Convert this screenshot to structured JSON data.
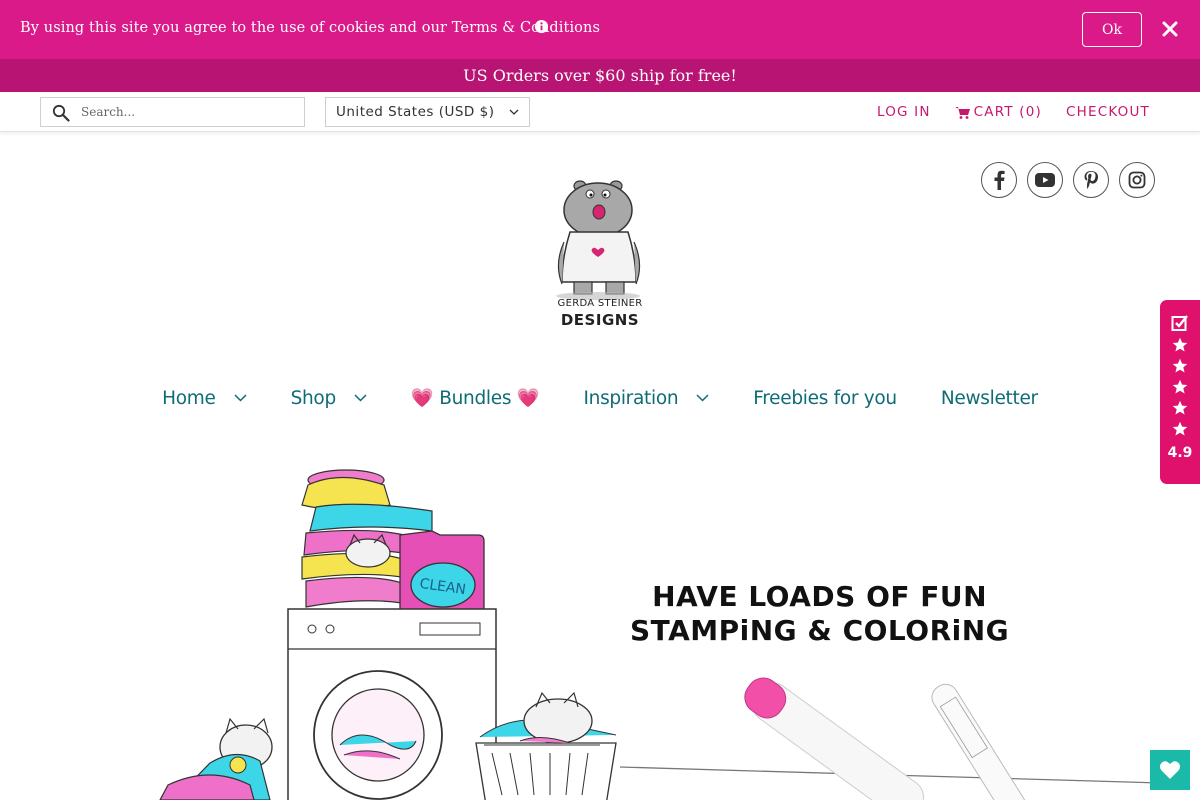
{
  "cookie_bar": {
    "text": "By using this site you agree to the use of cookies and our Terms & Conditions",
    "ok_label": "Ok",
    "background": "#db1a8a"
  },
  "shipping_banner": {
    "text": "US Orders over $60 ship for free!",
    "background": "#b81473"
  },
  "top_nav": {
    "search_placeholder": "Search...",
    "currency": "United States (USD $)",
    "login_label": "LOG IN",
    "cart_label": "CART (0)",
    "checkout_label": "CHECKOUT",
    "accent": "#c7186f"
  },
  "logo": {
    "line1": "GERDA STEINER",
    "line2": "DESIGNS"
  },
  "social": [
    "facebook-icon",
    "youtube-icon",
    "pinterest-icon",
    "instagram-icon"
  ],
  "main_nav": [
    {
      "label": "Home",
      "has_dropdown": true
    },
    {
      "label": "Shop",
      "has_dropdown": true
    },
    {
      "label": "💗 Bundles 💗",
      "has_dropdown": false
    },
    {
      "label": "Inspiration",
      "has_dropdown": true
    },
    {
      "label": "Freebies for you",
      "has_dropdown": false
    },
    {
      "label": "Newsletter",
      "has_dropdown": false
    }
  ],
  "reviews": {
    "rating": "4.9",
    "stars": 5,
    "background": "#e0106d"
  },
  "hero": {
    "line1": "HAVE LOADS OF FUN",
    "line2": "STAMPiNG & COLORiNG"
  },
  "wishlist": {
    "background": "#1ab9a8"
  }
}
